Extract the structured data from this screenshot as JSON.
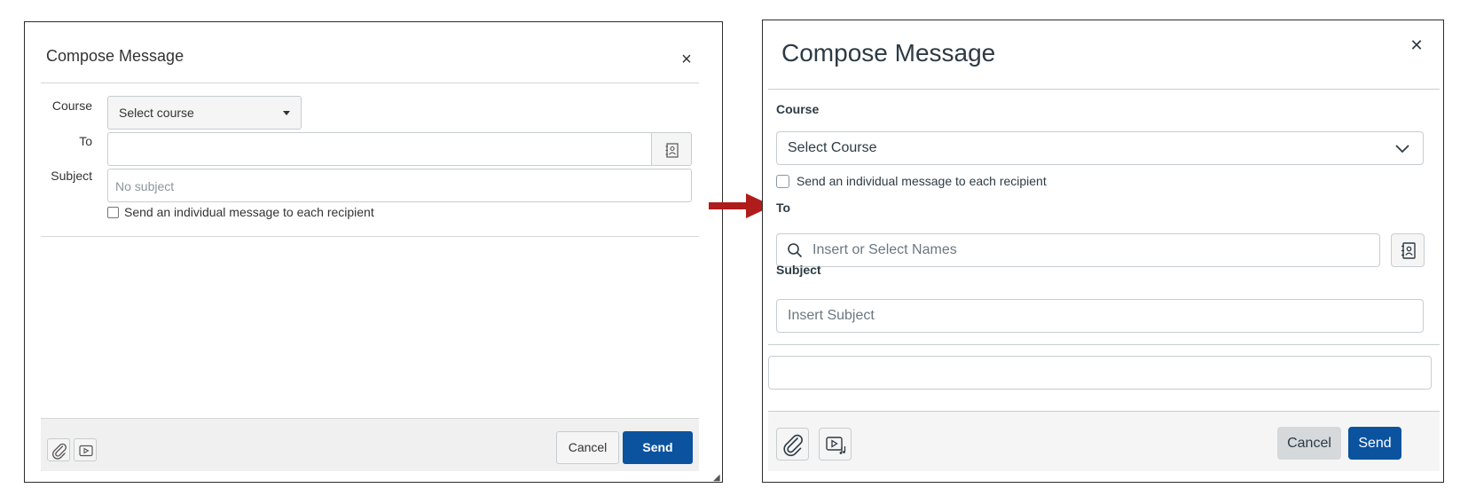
{
  "old_dialog": {
    "title": "Compose Message",
    "close_icon": "close-icon",
    "course_label": "Course",
    "course_select_value": "Select course",
    "to_label": "To",
    "to_value": "",
    "subject_label": "Subject",
    "subject_placeholder": "No subject",
    "individual_checkbox_label": "Send an individual message to each recipient",
    "tools": [
      "paperclip-icon",
      "media-icon"
    ],
    "cancel_label": "Cancel",
    "send_label": "Send"
  },
  "new_dialog": {
    "title": "Compose Message",
    "close_icon": "close-icon",
    "course_label": "Course",
    "course_select_value": "Select Course",
    "individual_checkbox_label": "Send an individual message to each recipient",
    "to_label": "To",
    "to_placeholder": "Insert or Select Names",
    "subject_label": "Subject",
    "subject_placeholder": "Insert Subject",
    "tools": [
      "paperclip-icon",
      "media-icon"
    ],
    "cancel_label": "Cancel",
    "send_label": "Send"
  },
  "colors": {
    "primary": "#0b539f",
    "arrow": "#b01c1c",
    "border": "#c7cdd1",
    "text": "#2d3b45"
  }
}
